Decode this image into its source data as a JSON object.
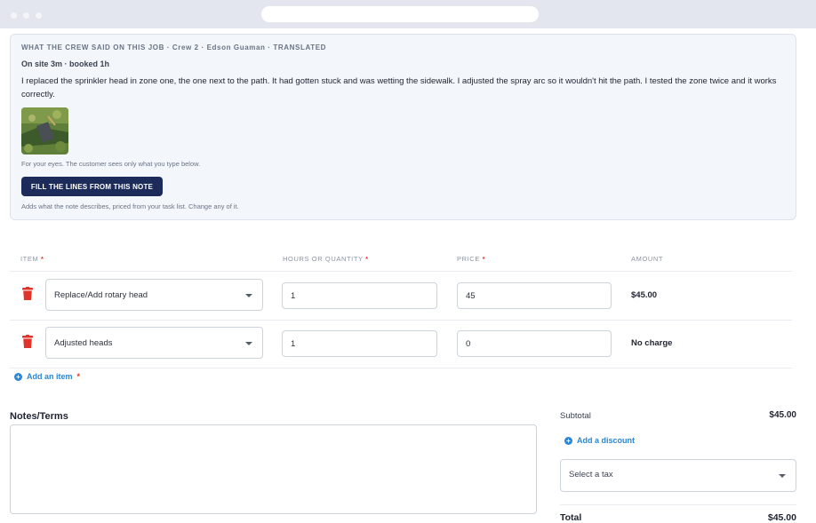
{
  "crew_note": {
    "header": "WHAT THE CREW SAID ON THIS JOB · Crew 2 · Edson Guaman · TRANSLATED",
    "onsite": "On site 3m · booked 1h",
    "note": "I replaced the sprinkler head in zone one, the one next to the path. It had gotten stuck and was wetting the sidewalk. I adjusted the spray arc so it wouldn't hit the path. I tested the zone twice and it works correctly.",
    "private_hint": "For your eyes. The customer sees only what you type below.",
    "fill_button": "FILL THE LINES FROM THIS NOTE",
    "fill_hint": "Adds what the note describes, priced from your task list. Change any of it."
  },
  "table": {
    "headers": {
      "item": "ITEM",
      "quantity": "HOURS OR QUANTITY",
      "price": "PRICE",
      "amount": "AMOUNT"
    },
    "required_mark": "*",
    "rows": [
      {
        "item": "Replace/Add rotary head",
        "quantity": "1",
        "price": "45",
        "amount": "$45.00"
      },
      {
        "item": "Adjusted heads",
        "quantity": "1",
        "price": "0",
        "amount": "No charge"
      }
    ],
    "add_item": "Add an item"
  },
  "notes": {
    "label": "Notes/Terms",
    "value": ""
  },
  "summary": {
    "subtotal_label": "Subtotal",
    "subtotal_value": "$45.00",
    "add_discount": "Add a discount",
    "tax_placeholder": "Select a tax",
    "total_label": "Total",
    "total_value": "$45.00"
  },
  "colors": {
    "primary_button": "#1d2b5a",
    "link": "#2b86d6",
    "required": "#e0342b",
    "delete": "#e0342b"
  }
}
